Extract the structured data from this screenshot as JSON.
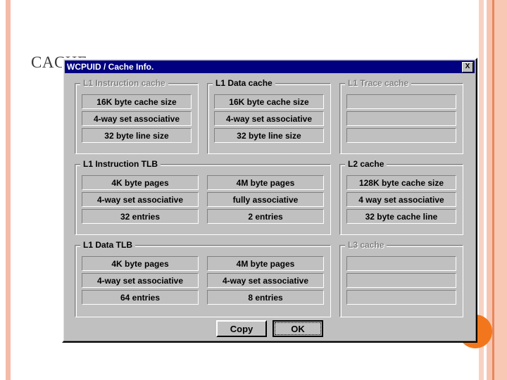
{
  "slide": {
    "title": "CACHE",
    "accent_color": "#f2771c",
    "stripe_color": "#f4bba9"
  },
  "dialog": {
    "title": "WCPUID / Cache Info.",
    "titlebar_color": "#000080",
    "close_icon": "X",
    "groups": [
      {
        "id": "l1_instruction_cache",
        "label": "L1 Instruction cache",
        "disabled": true,
        "columns": [
          {
            "fields": [
              "16K byte cache size",
              "4-way set associative",
              "32 byte line size"
            ]
          }
        ]
      },
      {
        "id": "l1_data_cache",
        "label": "L1 Data cache",
        "disabled": false,
        "columns": [
          {
            "fields": [
              "16K byte cache size",
              "4-way set associative",
              "32 byte line size"
            ]
          }
        ]
      },
      {
        "id": "l1_trace_cache",
        "label": "L1 Trace cache",
        "disabled": true,
        "columns": [
          {
            "fields": [
              "",
              "",
              ""
            ]
          }
        ]
      },
      {
        "id": "l1_instruction_tlb",
        "label": "L1 Instruction TLB",
        "disabled": false,
        "columns": [
          {
            "fields": [
              "4K byte pages",
              "4-way set associative",
              "32 entries"
            ]
          },
          {
            "fields": [
              "4M byte pages",
              "fully associative",
              "2 entries"
            ]
          }
        ]
      },
      {
        "id": "l2_cache",
        "label": "L2 cache",
        "disabled": false,
        "columns": [
          {
            "fields": [
              "128K byte cache size",
              "4 way set associative",
              "32 byte cache line"
            ]
          }
        ]
      },
      {
        "id": "l1_data_tlb",
        "label": "L1 Data TLB",
        "disabled": false,
        "columns": [
          {
            "fields": [
              "4K byte pages",
              "4-way set associative",
              "64 entries"
            ]
          },
          {
            "fields": [
              "4M byte pages",
              "4-way set associative",
              "8 entries"
            ]
          }
        ]
      },
      {
        "id": "l3_cache",
        "label": "L3 cache",
        "disabled": true,
        "columns": [
          {
            "fields": [
              "",
              "",
              ""
            ]
          }
        ]
      }
    ],
    "buttons": {
      "copy_label": "Copy",
      "ok_label": "OK"
    }
  }
}
